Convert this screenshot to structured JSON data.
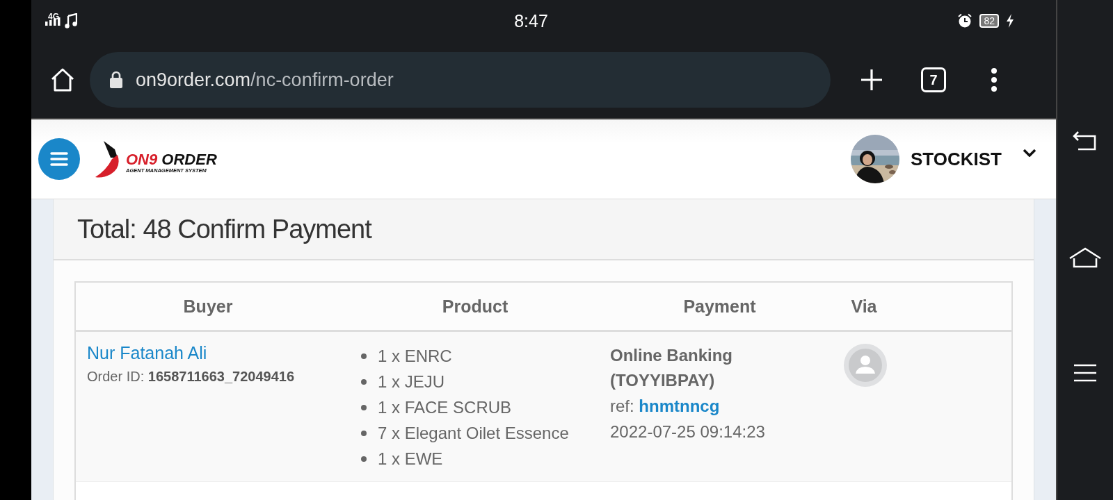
{
  "status_bar": {
    "network": "4G",
    "time": "8:47",
    "battery": "82"
  },
  "browser": {
    "url_host": "on9order.com",
    "url_path": "/nc-confirm-order",
    "tab_count": "7"
  },
  "header": {
    "logo": {
      "mark_text": "ON9",
      "text": "ORDER",
      "tagline": "AGENT MANAGEMENT SYSTEM"
    },
    "user": {
      "role": "STOCKIST"
    }
  },
  "panel": {
    "title": "Total: 48 Confirm Payment"
  },
  "table": {
    "columns": [
      "Buyer",
      "Product",
      "Payment",
      "Via"
    ],
    "rows": [
      {
        "buyer": "Nur Fatanah Ali",
        "order_label": "Order ID:",
        "order_id": "1658711663_72049416",
        "products": [
          "1 x ENRC",
          "1 x JEJU",
          "1 x FACE SCRUB",
          "7 x Elegant Oilet Essence",
          "1 x EWE"
        ],
        "payment_method": "Online Banking (TOYYIBPAY)",
        "ref_label": "ref:",
        "ref": "hnmtnncg",
        "date": "2022-07-25 09:14:23"
      }
    ]
  }
}
